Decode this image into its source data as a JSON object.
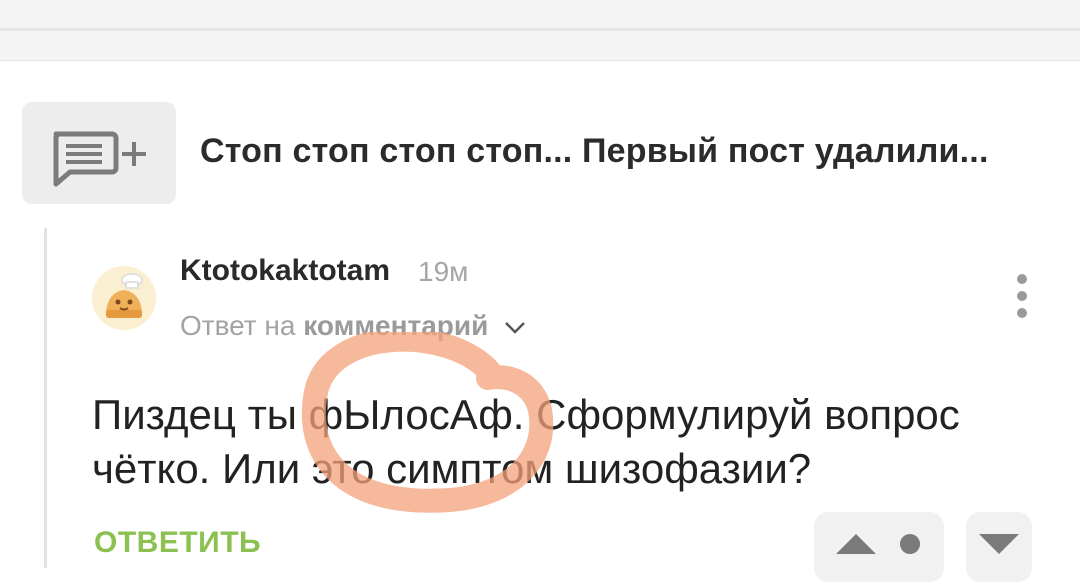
{
  "post": {
    "title": "Стоп стоп стоп стоп... Первый пост удалили..."
  },
  "comment": {
    "author": "Ktotokaktotam",
    "time": "19м",
    "reply_prefix": "Ответ на",
    "reply_target": "комментарий",
    "text_line1": "Пиздец ты фЫлосАф. Сформулируй вопрос",
    "text_line2": "чётко. Или это симптом шизофазии?",
    "reply_label": "ОТВЕТИТЬ"
  },
  "icons": {
    "add_comment": "comment-plus-icon",
    "expand": "chevron-down-icon",
    "menu": "kebab-menu-icon",
    "upvote": "arrow-up-icon",
    "neutral": "dot-icon",
    "downvote": "arrow-down-icon"
  },
  "colors": {
    "accent_green": "#8cc152",
    "annotation_orange": "#f4a27a"
  }
}
